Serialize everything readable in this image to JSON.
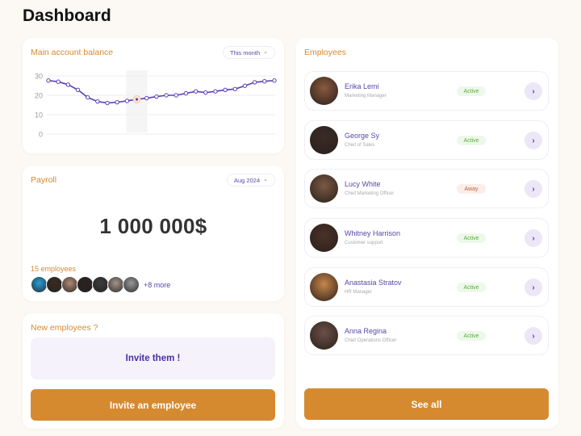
{
  "page": {
    "title": "Dashboard"
  },
  "colors": {
    "accent_orange": "#d58a30",
    "accent_purple": "#5a47a6",
    "active_green": "#5dab3e",
    "away_red": "#c0623e",
    "background": "#fcf8f3"
  },
  "balance": {
    "title": "Main account balance",
    "period_select": "This month",
    "chevron_icon": "chevron-down-icon"
  },
  "chart_data": {
    "type": "line",
    "title": "Main account balance",
    "xlabel": "",
    "ylabel": "",
    "ylim": [
      0,
      30
    ],
    "yticks": [
      0,
      10,
      20,
      30
    ],
    "ytick_labels": [
      "0",
      "10",
      "20",
      "30"
    ],
    "grid": true,
    "highlight_index": 9,
    "series": [
      {
        "name": "Balance",
        "color": "#5a3fb8",
        "values": [
          27.6,
          27.0,
          25.5,
          22.8,
          18.9,
          16.8,
          16.0,
          16.4,
          17.1,
          17.9,
          18.5,
          19.3,
          20.0,
          20.0,
          21.0,
          22.0,
          21.4,
          22.0,
          22.8,
          23.2,
          24.9,
          26.7,
          27.2,
          27.6
        ]
      }
    ]
  },
  "payroll": {
    "title": "Payroll",
    "period_select": "Aug 2024",
    "amount": "1 000 000$",
    "employee_count": "15 employees",
    "more_label": "+8 more",
    "avatars": [
      "#2a9fd6",
      "#3a2a22",
      "#b08a74",
      "#2b2320",
      "#3c3c3c",
      "#a4948a",
      "#9a9a9a"
    ]
  },
  "new_employees": {
    "title": "New employees ?",
    "invite_text": "Invite them !",
    "button_label": "Invite an employee"
  },
  "employees": {
    "title": "Employees",
    "see_all_label": "See all",
    "list": [
      {
        "name": "Erika Lemi",
        "role": "Marketing Manager",
        "status": "Active",
        "status_type": "active",
        "avatar_color": "#8a5a40"
      },
      {
        "name": "George Sy",
        "role": "Chief of Sales",
        "status": "Active",
        "status_type": "active",
        "avatar_color": "#3a2c26"
      },
      {
        "name": "Lucy White",
        "role": "Chief Marketing Officer",
        "status": "Away",
        "status_type": "away",
        "avatar_color": "#7a5a44"
      },
      {
        "name": "Whitney Harrison",
        "role": "Customer support",
        "status": "Active",
        "status_type": "active",
        "avatar_color": "#4a3228"
      },
      {
        "name": "Anastasia Stratov",
        "role": "HR Manager",
        "status": "Active",
        "status_type": "active",
        "avatar_color": "#c8864a"
      },
      {
        "name": "Anna Regina",
        "role": "Chief Operations Officer",
        "status": "Active",
        "status_type": "active",
        "avatar_color": "#6a5046"
      }
    ]
  }
}
